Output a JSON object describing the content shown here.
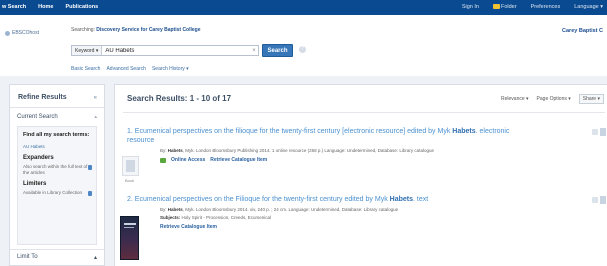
{
  "topbar": {
    "nav": [
      "w Search",
      "Home",
      "Publications"
    ],
    "right": {
      "signin": "Sign In",
      "folder": "Folder",
      "preferences": "Preferences",
      "language": "Language ▾"
    }
  },
  "header": {
    "logo_text": "EBSCOhost",
    "searching_prefix": "Searching:",
    "searching_db": "Discovery Service for Carey Baptist College",
    "institution": "Carey Baptist C",
    "field_select": "Keyword ▾",
    "query": "AU Habets",
    "clear": "×",
    "search_button": "Search",
    "help": "?",
    "links": [
      "Basic Search",
      "Advanced Search",
      "Search History ▾"
    ]
  },
  "sidebar": {
    "title": "Refine Results",
    "current_search": "Current Search",
    "find_label": "Find all my search terms:",
    "find_term": "AU Habets",
    "expanders_heading": "Expanders",
    "expander_option": "Also search within the full text of the articles",
    "limiters_heading": "Limiters",
    "limiter_option": "Available in Library Collection",
    "limit_to": "Limit To"
  },
  "main": {
    "results_heading": "Search Results: 1 - 10 of 17",
    "tools": {
      "relevance": "Relevance ▾",
      "page_options": "Page Options ▾",
      "share": "Share ▾"
    },
    "results": [
      {
        "number": "1.",
        "title_pre": "Ecumenical perspectives on the filioque for the twenty-first century [electronic resource] edited by Myk",
        "title_bold": "Habets",
        "title_post": ". electronic resource",
        "meta_by": "By:",
        "meta_author": "Habets",
        "meta_rest": ", Myk. London Bloomsbury Publishing 2014. 1 online resource (258 p.) Language: Undetermined, Database: Library catalogue",
        "thumb_label": "Book",
        "online_access": "Online Access",
        "retrieve": "Retrieve Catalogue Item"
      },
      {
        "number": "2.",
        "title_pre": "Ecumenical perspectives on the Filioque for the twenty-first century edited by Myk",
        "title_bold": "Habets",
        "title_post": ". text",
        "meta_by": "By:",
        "meta_author": "Habets",
        "meta_rest": ", Myk. London Bloomsbury 2014. xiv, 240 p. ; 24 cm. Language: Undetermined, Database: Library catalogue",
        "subjects_label": "Subjects:",
        "subjects": "Holy Spirit - Procession, Creeds, Ecumenical",
        "retrieve": "Retrieve Catalogue Item"
      }
    ]
  }
}
